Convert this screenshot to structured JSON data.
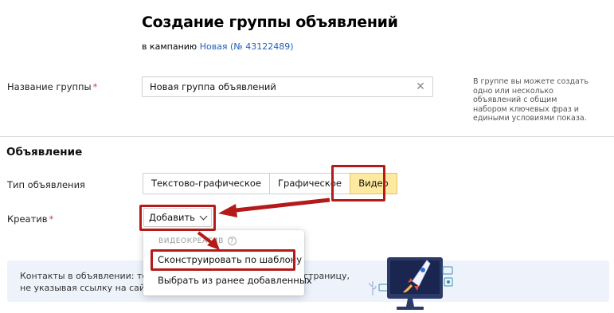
{
  "header": {
    "title": "Создание группы объявлений",
    "campaign_prefix": "в кампанию",
    "campaign_link": "Новая (№ 43122489)"
  },
  "group": {
    "label": "Название группы",
    "required_mark": "*",
    "value": "Новая группа объявлений",
    "hint": "В группе вы можете создать одно или несколько объявлений с общим набором ключевых фраз и едиными условиями показа."
  },
  "ad": {
    "section_title": "Объявление",
    "type_label": "Тип объявления",
    "types": [
      {
        "label": "Текстово-графическое",
        "selected": false
      },
      {
        "label": "Графическое",
        "selected": false
      },
      {
        "label": "Видео",
        "selected": true
      }
    ],
    "creative_label": "Креатив",
    "creative_required": "*",
    "add_button": "Добавить"
  },
  "dropdown": {
    "header": "ВИДЕОКРЕАТИВ",
    "help": "?",
    "items": [
      "Сконструировать по шаблону",
      "Выбрать из ранее добавленных"
    ]
  },
  "banner": {
    "line1_left": "Контакты в объявлении: тепе",
    "line1_right": "страницу,",
    "line2": "не указывая ссылку на сайт."
  },
  "colors": {
    "accent_link": "#1f5fb4",
    "selected_bg": "#fde9a0",
    "highlight": "#b51a1a",
    "banner_bg": "#eef3fb",
    "required": "#e0393e"
  },
  "icons": {
    "clear": "close-icon",
    "add_chevron": "chevron-down-icon",
    "help": "question-icon"
  }
}
